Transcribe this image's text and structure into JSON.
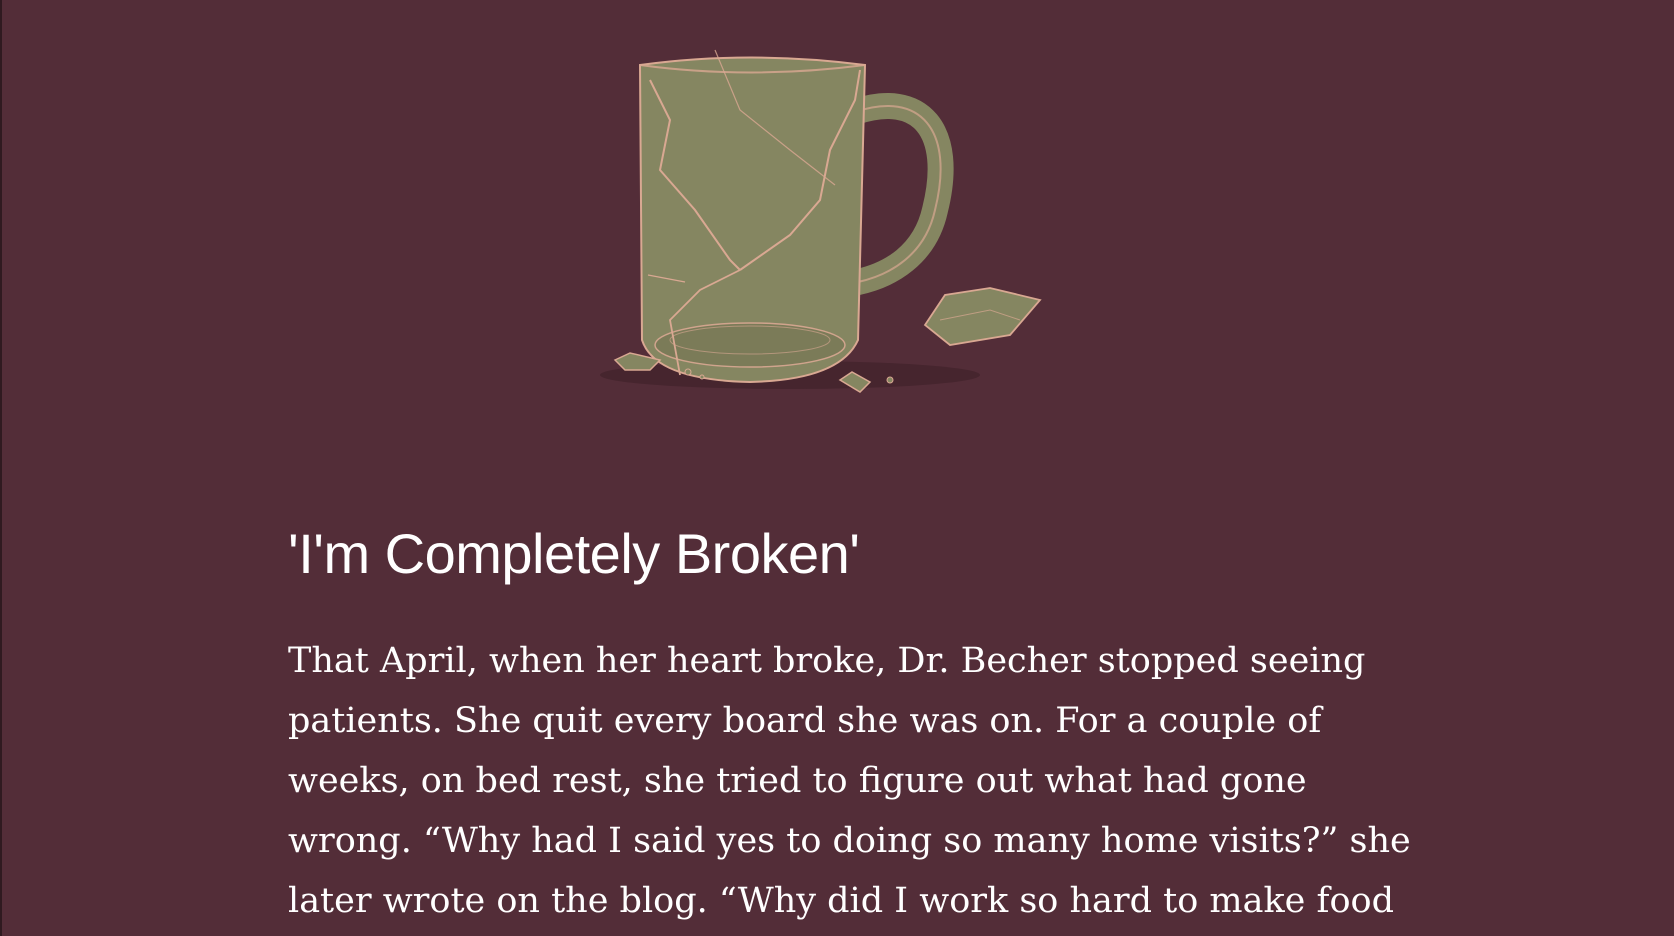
{
  "illustration": {
    "icon": "broken-mug-icon",
    "colors": {
      "glass": "#858661",
      "glass_dark": "#6b6a4e",
      "crack": "#d9a892",
      "shadow": "#3d1f28"
    }
  },
  "article": {
    "section_title": "'I'm Completely Broken'",
    "paragraph_lines": [
      "That April, when her heart broke, Dr. Becher stopped seeing",
      "patients. She quit every board she was on. For a couple of",
      "weeks, on bed rest, she tried to figure out what had gone",
      "wrong. “Why had I said yes to doing so many home visits?” she",
      "later wrote on the blog. “Why did I work so hard to make food"
    ]
  },
  "colors": {
    "background": "#532d38",
    "text": "#ffffff"
  }
}
